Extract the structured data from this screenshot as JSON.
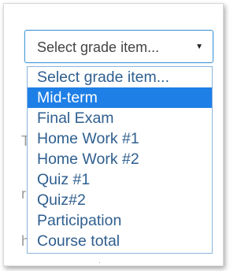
{
  "select": {
    "value": "Select grade item...",
    "arrow_icon": "chevron-down-icon"
  },
  "dropdown": {
    "options": [
      "Select grade item...",
      "Mid-term",
      "Final Exam",
      "Home Work #1",
      "Home Work #2",
      "Quiz #1",
      "Quiz#2",
      "Participation",
      "Course total"
    ],
    "selected_index": 1
  },
  "colors": {
    "select_border": "#4b9ad6",
    "option_text": "#2f5f8f",
    "selected_bg": "#1e7fe6"
  }
}
